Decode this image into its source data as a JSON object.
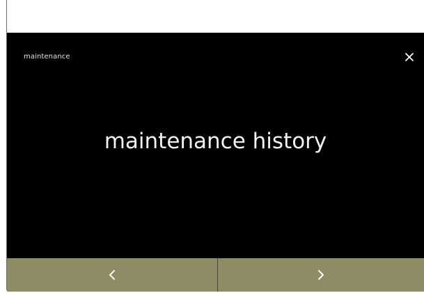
{
  "screen": {
    "title": "maintenance",
    "heading": "maintenance history"
  },
  "icons": {
    "close": "close-icon",
    "previous": "chevron-left-icon",
    "next": "chevron-right-icon"
  },
  "colors": {
    "screen_background": "#000000",
    "nav_bar": "#8e8c64",
    "text": "#f2f2f2"
  }
}
